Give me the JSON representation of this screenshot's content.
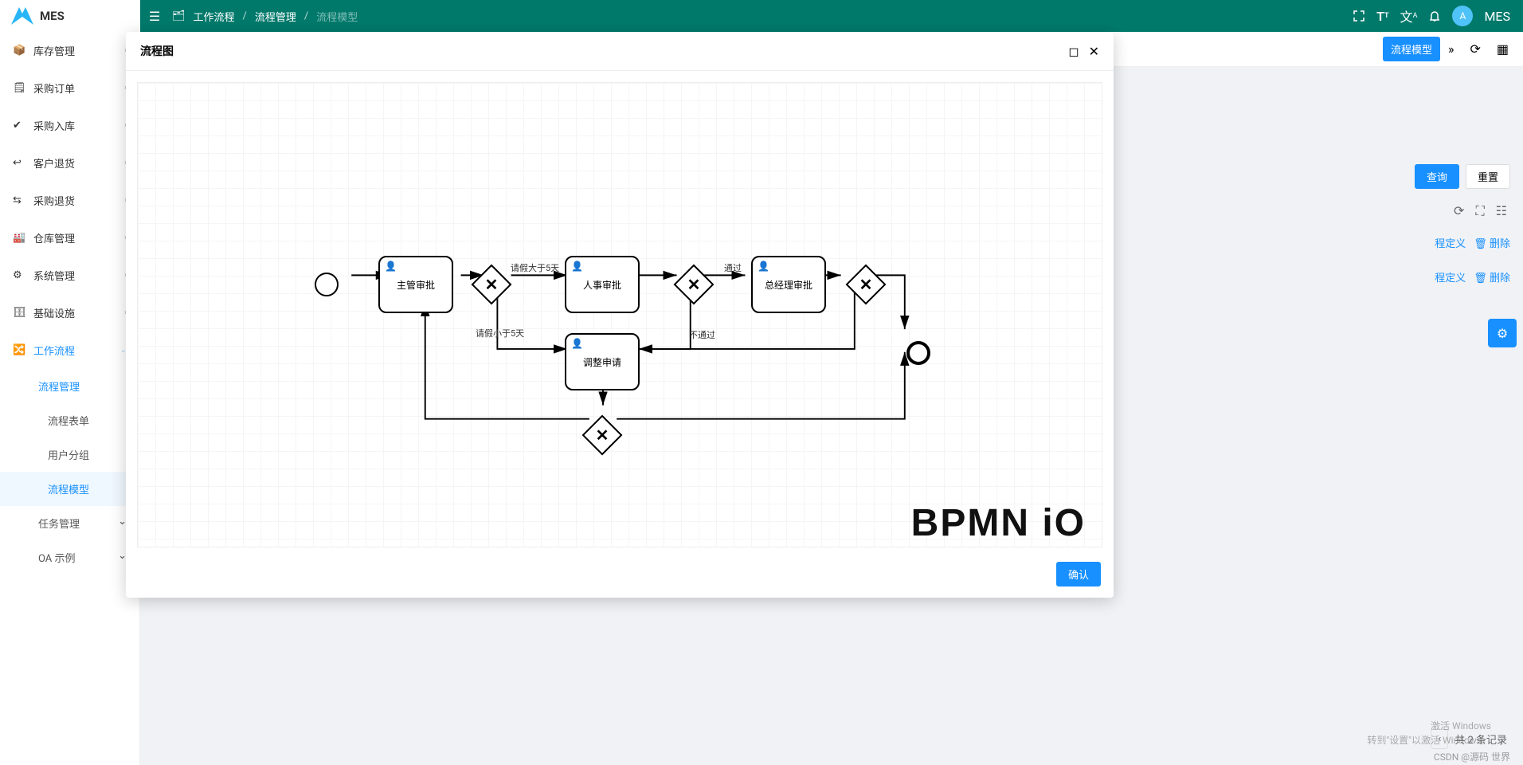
{
  "app": {
    "name": "MES",
    "user": "MES"
  },
  "breadcrumb": {
    "icon": "workflow",
    "root": "工作流程",
    "mid": "流程管理",
    "last": "流程模型"
  },
  "sidebar": {
    "items": [
      {
        "icon": "inventory",
        "label": "库存管理"
      },
      {
        "icon": "purchase-order",
        "label": "采购订单"
      },
      {
        "icon": "purchase-in",
        "label": "采购入库"
      },
      {
        "icon": "customer-return",
        "label": "客户退货"
      },
      {
        "icon": "purchase-return",
        "label": "采购退货"
      },
      {
        "icon": "warehouse",
        "label": "仓库管理"
      },
      {
        "icon": "system",
        "label": "系统管理"
      },
      {
        "icon": "infrastructure",
        "label": "基础设施"
      },
      {
        "icon": "workflow",
        "label": "工作流程",
        "active": true
      }
    ],
    "subItems": [
      {
        "label": "流程管理",
        "active": true
      },
      {
        "label": "流程表单"
      },
      {
        "label": "用户分组"
      },
      {
        "label": "流程模型",
        "highlight": true
      },
      {
        "label": "任务管理",
        "chev": true
      },
      {
        "label": "OA 示例",
        "chev": true
      }
    ]
  },
  "tabs": {
    "activeTab": "流程模型"
  },
  "actions": {
    "search": "查询",
    "reset": "重置"
  },
  "tableLinks": {
    "definition": "程定义",
    "delete": "删除"
  },
  "pager": {
    "total": "共 2 条记录"
  },
  "modal": {
    "title": "流程图",
    "confirm": "确认",
    "watermark": "BPMN iO",
    "nodes": {
      "task1": "主管审批",
      "task2": "人事审批",
      "task3": "总经理审批",
      "task4": "调整申请",
      "flow_gt5": "请假大于5天",
      "flow_lt5": "请假小于5天",
      "flow_pass": "通过",
      "flow_fail": "不通过"
    }
  },
  "watermarks": {
    "activate1": "激活 Windows",
    "activate2": "转到\"设置\"以激活 Windows。",
    "csdn": "CSDN @源码 世界"
  }
}
